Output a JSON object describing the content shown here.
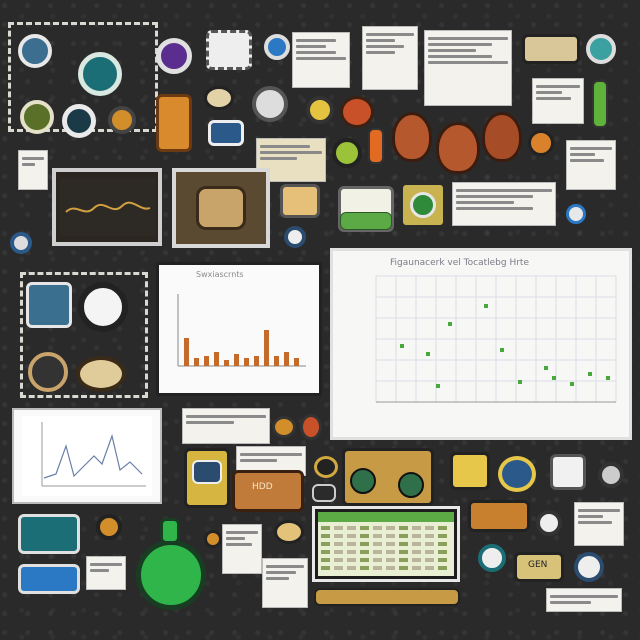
{
  "scatter_panel": {
    "title": "Figaunacerk vel Tocatlebg Hrte"
  },
  "bar_panel": {
    "title": "Swxiascrnts"
  },
  "keyboard_tile": {
    "label": "HDD"
  },
  "badge_tile": {
    "label": "GEN"
  },
  "colors": {
    "background": "#2a2a2a",
    "scatter_point": "#49a83b",
    "bar": "#c46a2a",
    "leaf": "#b5582e",
    "flask": "#2fb54a"
  },
  "icons": [
    "camera-icon",
    "tv-icon",
    "swirl-icon",
    "leaf-icon",
    "flask-icon",
    "gear-icon",
    "document-icon",
    "monitor-icon",
    "drum-icon",
    "glasses-icon"
  ]
}
